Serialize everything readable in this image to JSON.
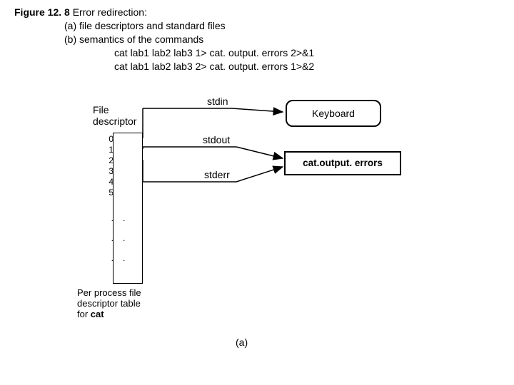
{
  "caption": {
    "fig_label": "Figure 12. 8",
    "title": "Error redirection:",
    "line_a": "(a) file descriptors and standard files",
    "line_b": "(b) semantics of the commands",
    "cmd1": "cat lab1 lab2 lab3 1> cat. output. errors 2>&1",
    "cmd2": "cat lab1 lab2 lab3 2> cat. output. errors 1>&2"
  },
  "diagram": {
    "fd_label_line1": "File",
    "fd_label_line2": "descriptor",
    "fd_rows": [
      "0",
      "1",
      "2",
      "3",
      "4",
      "5",
      ".",
      ".",
      "."
    ],
    "stdin": "stdin",
    "stdout": "stdout",
    "stderr": "stderr",
    "keyboard": "Keyboard",
    "output_box": "cat.output. errors",
    "fd_caption_l1": "Per process file",
    "fd_caption_l2": "descriptor table",
    "fd_caption_for": "for ",
    "fd_caption_cat": "cat",
    "sublabel": "(a)"
  }
}
